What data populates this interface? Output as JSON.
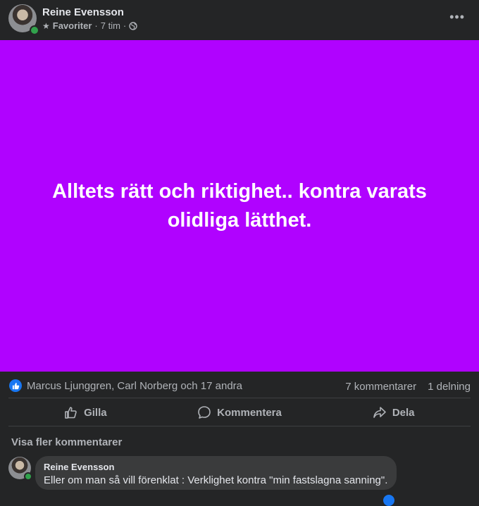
{
  "post": {
    "author": "Reine Evensson",
    "favorites_label": "Favoriter",
    "time": "7 tim",
    "separator": "·",
    "text": "Alltets rätt och riktighet.. kontra varats olidliga lätthet.",
    "background_color": "#b002ff"
  },
  "reactions": {
    "names": "Marcus Ljunggren, Carl Norberg och 17 andra",
    "comments_count": "7 kommentarer",
    "shares_count": "1 delning"
  },
  "actions": {
    "like": "Gilla",
    "comment": "Kommentera",
    "share": "Dela"
  },
  "comments": {
    "more_label": "Visa fler kommentarer",
    "items": [
      {
        "author": "Reine Evensson",
        "text": "Eller om man så vill förenklat : Verklighet kontra \"min fastslagna sanning\"."
      }
    ]
  },
  "icons": {
    "star": "star-icon",
    "globe": "globe-icon",
    "more": "more-options-icon",
    "like_badge": "like-icon",
    "thumbs_up": "thumbs-up-icon",
    "comment": "comment-icon",
    "share": "share-icon"
  },
  "colors": {
    "accent": "#1877f2",
    "online": "#31a24c",
    "surface": "#242526"
  }
}
